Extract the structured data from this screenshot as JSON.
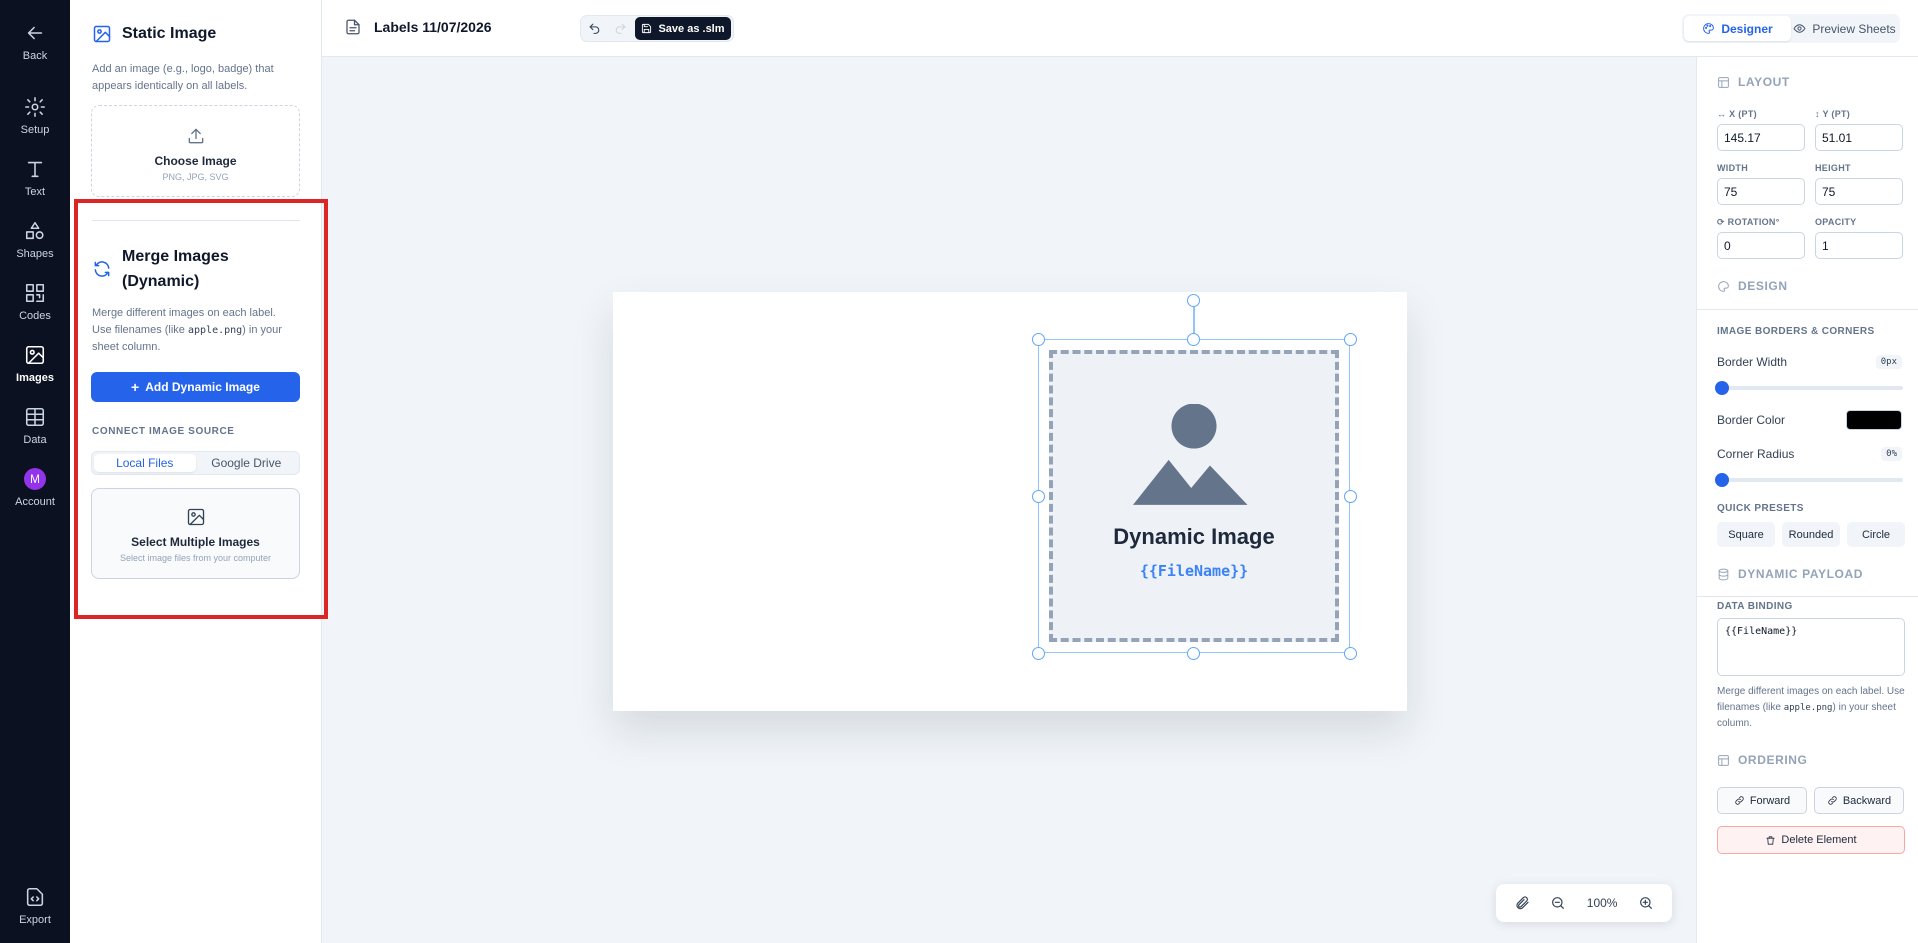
{
  "rail": {
    "back": "Back",
    "setup": "Setup",
    "text": "Text",
    "shapes": "Shapes",
    "codes": "Codes",
    "images": "Images",
    "data": "Data",
    "account_initial": "M",
    "account": "Account",
    "export": "Export"
  },
  "panel": {
    "static_title": "Static Image",
    "static_desc": "Add an image (e.g., logo, badge) that appears identically on all labels.",
    "choose_title": "Choose Image",
    "choose_sub": "PNG, JPG, SVG",
    "merge_title": "Merge Images (Dynamic)",
    "merge_desc_1": "Merge different images on each label. Use filenames (like",
    "merge_desc_code": "apple.png",
    "merge_desc_2": ") in your sheet column.",
    "add_button": "Add Dynamic Image",
    "connect_label": "CONNECT IMAGE SOURCE",
    "source_tabs": [
      "Local Files",
      "Google Drive"
    ],
    "multi_title": "Select Multiple Images",
    "multi_sub": "Select image files from your computer"
  },
  "topbar": {
    "doc_title": "Labels 11/07/2026",
    "save_label": "Save as .slm",
    "modes": [
      "Designer",
      "Preview Sheets"
    ]
  },
  "canvas": {
    "placeholder_title": "Dynamic Image",
    "placeholder_binding": "{{FileName}}",
    "zoom": "100%"
  },
  "inspector": {
    "layout_head": "LAYOUT",
    "x_label": "X (PT)",
    "x_value": "145.17",
    "y_label": "Y (PT)",
    "y_value": "51.01",
    "width_label": "WIDTH",
    "width_value": "75",
    "height_label": "HEIGHT",
    "height_value": "75",
    "rotation_label": "ROTATION°",
    "rotation_value": "0",
    "opacity_label": "OPACITY",
    "opacity_value": "1",
    "design_head": "DESIGN",
    "borders_head": "IMAGE BORDERS & CORNERS",
    "border_width_label": "Border Width",
    "border_width_value": "0px",
    "border_color_label": "Border Color",
    "border_color": "#000000",
    "corner_radius_label": "Corner Radius",
    "corner_radius_value": "0%",
    "presets_label": "QUICK PRESETS",
    "presets": [
      "Square",
      "Rounded",
      "Circle"
    ],
    "payload_head": "DYNAMIC PAYLOAD",
    "binding_label": "DATA BINDING",
    "binding_value": "{{FileName}}",
    "payload_desc_1": "Merge different images on each label. Use filenames (like",
    "payload_desc_code": "apple.png",
    "payload_desc_2": ") in your sheet column.",
    "ordering_head": "ORDERING",
    "forward": "Forward",
    "backward": "Backward",
    "delete": "Delete Element"
  },
  "colors": {
    "accent": "#2563eb",
    "rail_bg": "#0b1120",
    "highlight": "#dc2626"
  }
}
